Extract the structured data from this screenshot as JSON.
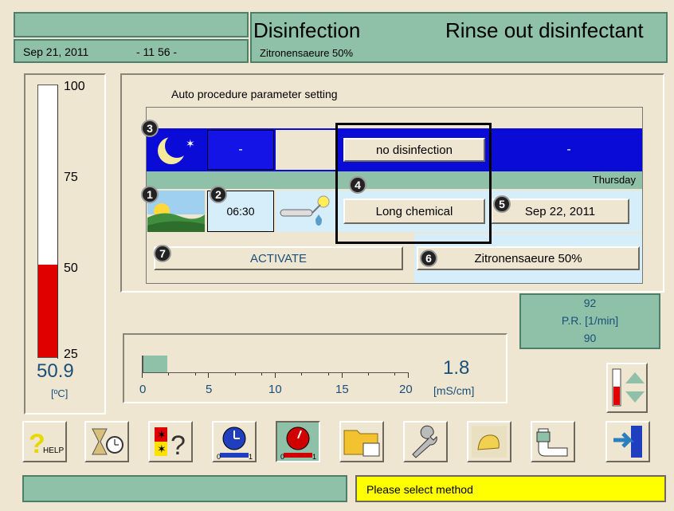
{
  "header": {
    "date": "Sep 21, 2011",
    "time": "- 11 56 -",
    "mode": "Disinfection",
    "phase": "Rinse out disinfectant",
    "agent": "Zitronensaeure 50%"
  },
  "thermometer": {
    "labels": [
      "100",
      "75",
      "50",
      "25"
    ],
    "value": "50.9",
    "unit": "[ºC]",
    "fill_fraction": 0.34
  },
  "dialog": {
    "title": "Auto procedure parameter setting",
    "night_left_value": "-",
    "night_right_value": "-",
    "no_disinfection": "no disinfection",
    "weekday": "Thursday",
    "time_value": "06:30",
    "long_chemical": "Long chemical",
    "date_value": "Sep 22, 2011",
    "activate": "ACTIVATE",
    "agent_button": "Zitronensaeure 50%",
    "badges": [
      "1",
      "2",
      "3",
      "4",
      "5",
      "6",
      "7"
    ]
  },
  "pr_panel": {
    "top": "92",
    "label": "P.R. [1/min]",
    "bottom": "90"
  },
  "conductivity": {
    "value": "1.8",
    "unit": "[mS/cm]",
    "ticks": [
      "0",
      "5",
      "10",
      "15",
      "20"
    ],
    "fill_fraction": 0.09
  },
  "toolbar": {
    "help_label": "HELP"
  },
  "status": {
    "message": "Please select method",
    "message_color": "#ffff00"
  }
}
